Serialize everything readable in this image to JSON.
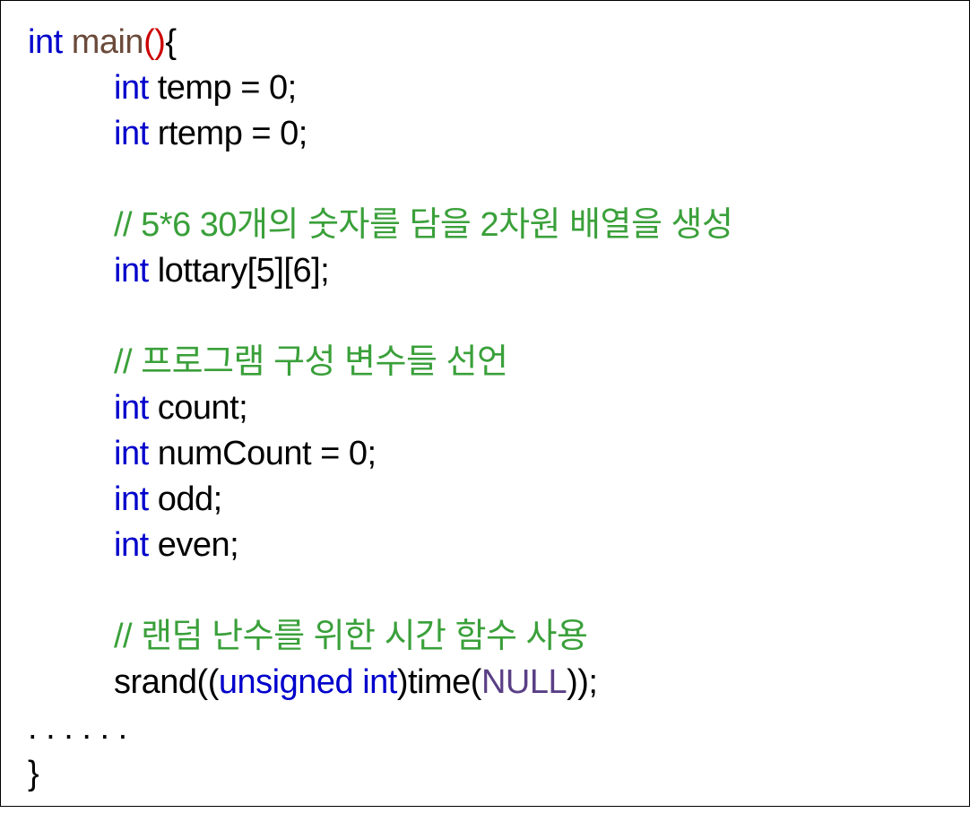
{
  "colors": {
    "keyword": "#0000cc",
    "function_name": "#6b4a3a",
    "paren_highlight": "#cc0000",
    "comment": "#3aa03a",
    "constant": "#5a3f86",
    "text": "#000000",
    "background": "#ffffff"
  },
  "code": {
    "l1": {
      "kw": "int",
      "fn": " main",
      "paren": "()",
      "rest": "{"
    },
    "l2": {
      "kw": "int",
      "rest": " temp = 0;"
    },
    "l3": {
      "kw": "int",
      "rest": " rtemp = 0;"
    },
    "l5": {
      "comment": "// 5*6 30개의 숫자를 담을 2차원 배열을 생성"
    },
    "l6": {
      "kw": "int",
      "rest": " lottary[5][6];"
    },
    "l8": {
      "comment": "// 프로그램 구성 변수들 선언"
    },
    "l9": {
      "kw": "int",
      "rest": " count;"
    },
    "l10": {
      "kw": "int",
      "rest": " numCount = 0;"
    },
    "l11": {
      "kw": "int",
      "rest": " odd;"
    },
    "l12": {
      "kw": "int",
      "rest": " even;"
    },
    "l14": {
      "comment": "// 랜덤 난수를 위한 시간 함수 사용"
    },
    "l15": {
      "pre": "srand((",
      "kw1": "unsigned",
      "sp": " ",
      "kw2": "int",
      "mid": ")time(",
      "const": "NULL",
      "post": "));"
    },
    "l16": {
      "rest": ". . . . . ."
    },
    "l17": {
      "rest": "}"
    }
  }
}
